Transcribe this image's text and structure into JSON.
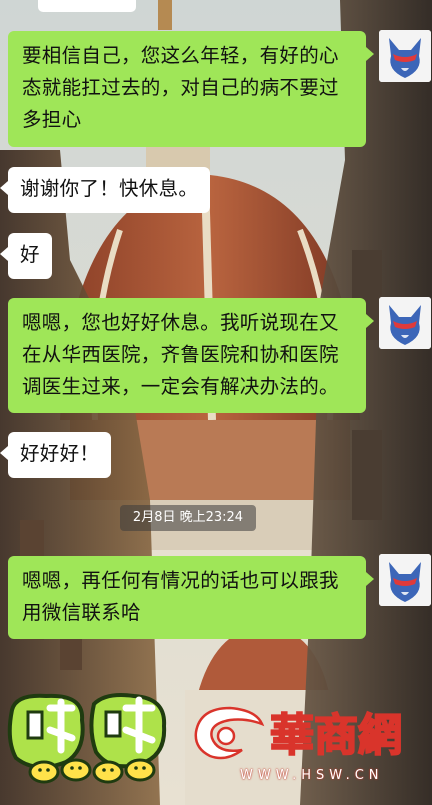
{
  "conversation": {
    "messages": [
      {
        "side": "sent",
        "text": "要相信自己，您这么年轻，有好的心态就能扛过去的，对自己的病不要过多担心"
      },
      {
        "side": "received",
        "text": "谢谢你了！快休息。"
      },
      {
        "side": "received",
        "text": "好"
      },
      {
        "side": "sent",
        "text": "嗯嗯，您也好好休息。我听说现在又在从华西医院，齐鲁医院和协和医院调医生过来，一定会有解决办法的。"
      },
      {
        "side": "received",
        "text": "好好好！"
      },
      {
        "side": "sent",
        "text": "嗯嗯，再任何有情况的话也可以跟我用微信联系哈"
      }
    ],
    "timestamp": "2月8日 晚上23:24"
  },
  "sticker": {
    "text": "哒哒",
    "icon": "chick-sticker"
  },
  "watermark": {
    "brand": "華商網",
    "url": "WWW.HSW.CN",
    "icon": "hsw-logo-icon"
  },
  "colors": {
    "sent_bubble": "#9fe658",
    "received_bubble": "#ffffff",
    "watermark": "#d9342b"
  }
}
